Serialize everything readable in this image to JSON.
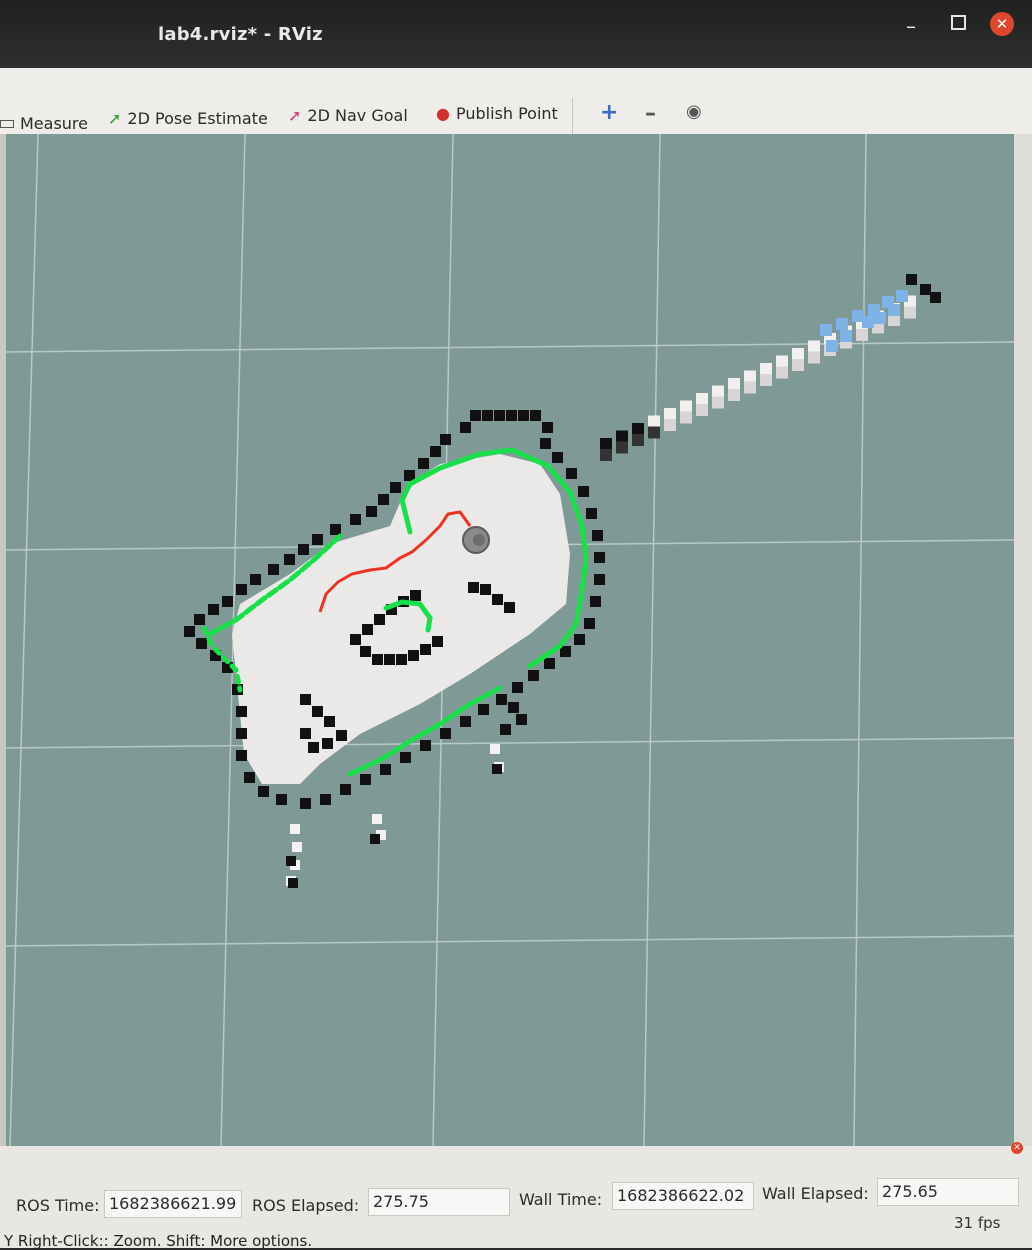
{
  "window": {
    "title": "lab4.rviz* - RViz",
    "minimize": "–",
    "close": "✕"
  },
  "toolbar": {
    "measure": "Measure",
    "pose_estimate": "2D Pose Estimate",
    "nav_goal": "2D Nav Goal",
    "publish_point": "Publish Point",
    "zoom_in_icon": "+",
    "zoom_out_icon": "–",
    "view_icon": "◉"
  },
  "status": {
    "ros_time_label": "ROS Time:",
    "ros_time": "1682386621.99",
    "ros_elapsed_label": "ROS Elapsed:",
    "ros_elapsed": "275.75",
    "wall_time_label": "Wall Time:",
    "wall_time": "1682386622.02",
    "wall_elapsed_label": "Wall Elapsed:",
    "wall_elapsed": "275.65",
    "hint": "Y Right-Click:: Zoom. Shift: More options.",
    "fps": "31 fps"
  },
  "colors": {
    "background": "#7f9a96",
    "grid": "#b9c9c5",
    "free": "#ebe8e8",
    "occupied": "#111111",
    "laser": "#19e04a",
    "path": "#ee3322",
    "scan_ahead": "#7fb2e6"
  }
}
